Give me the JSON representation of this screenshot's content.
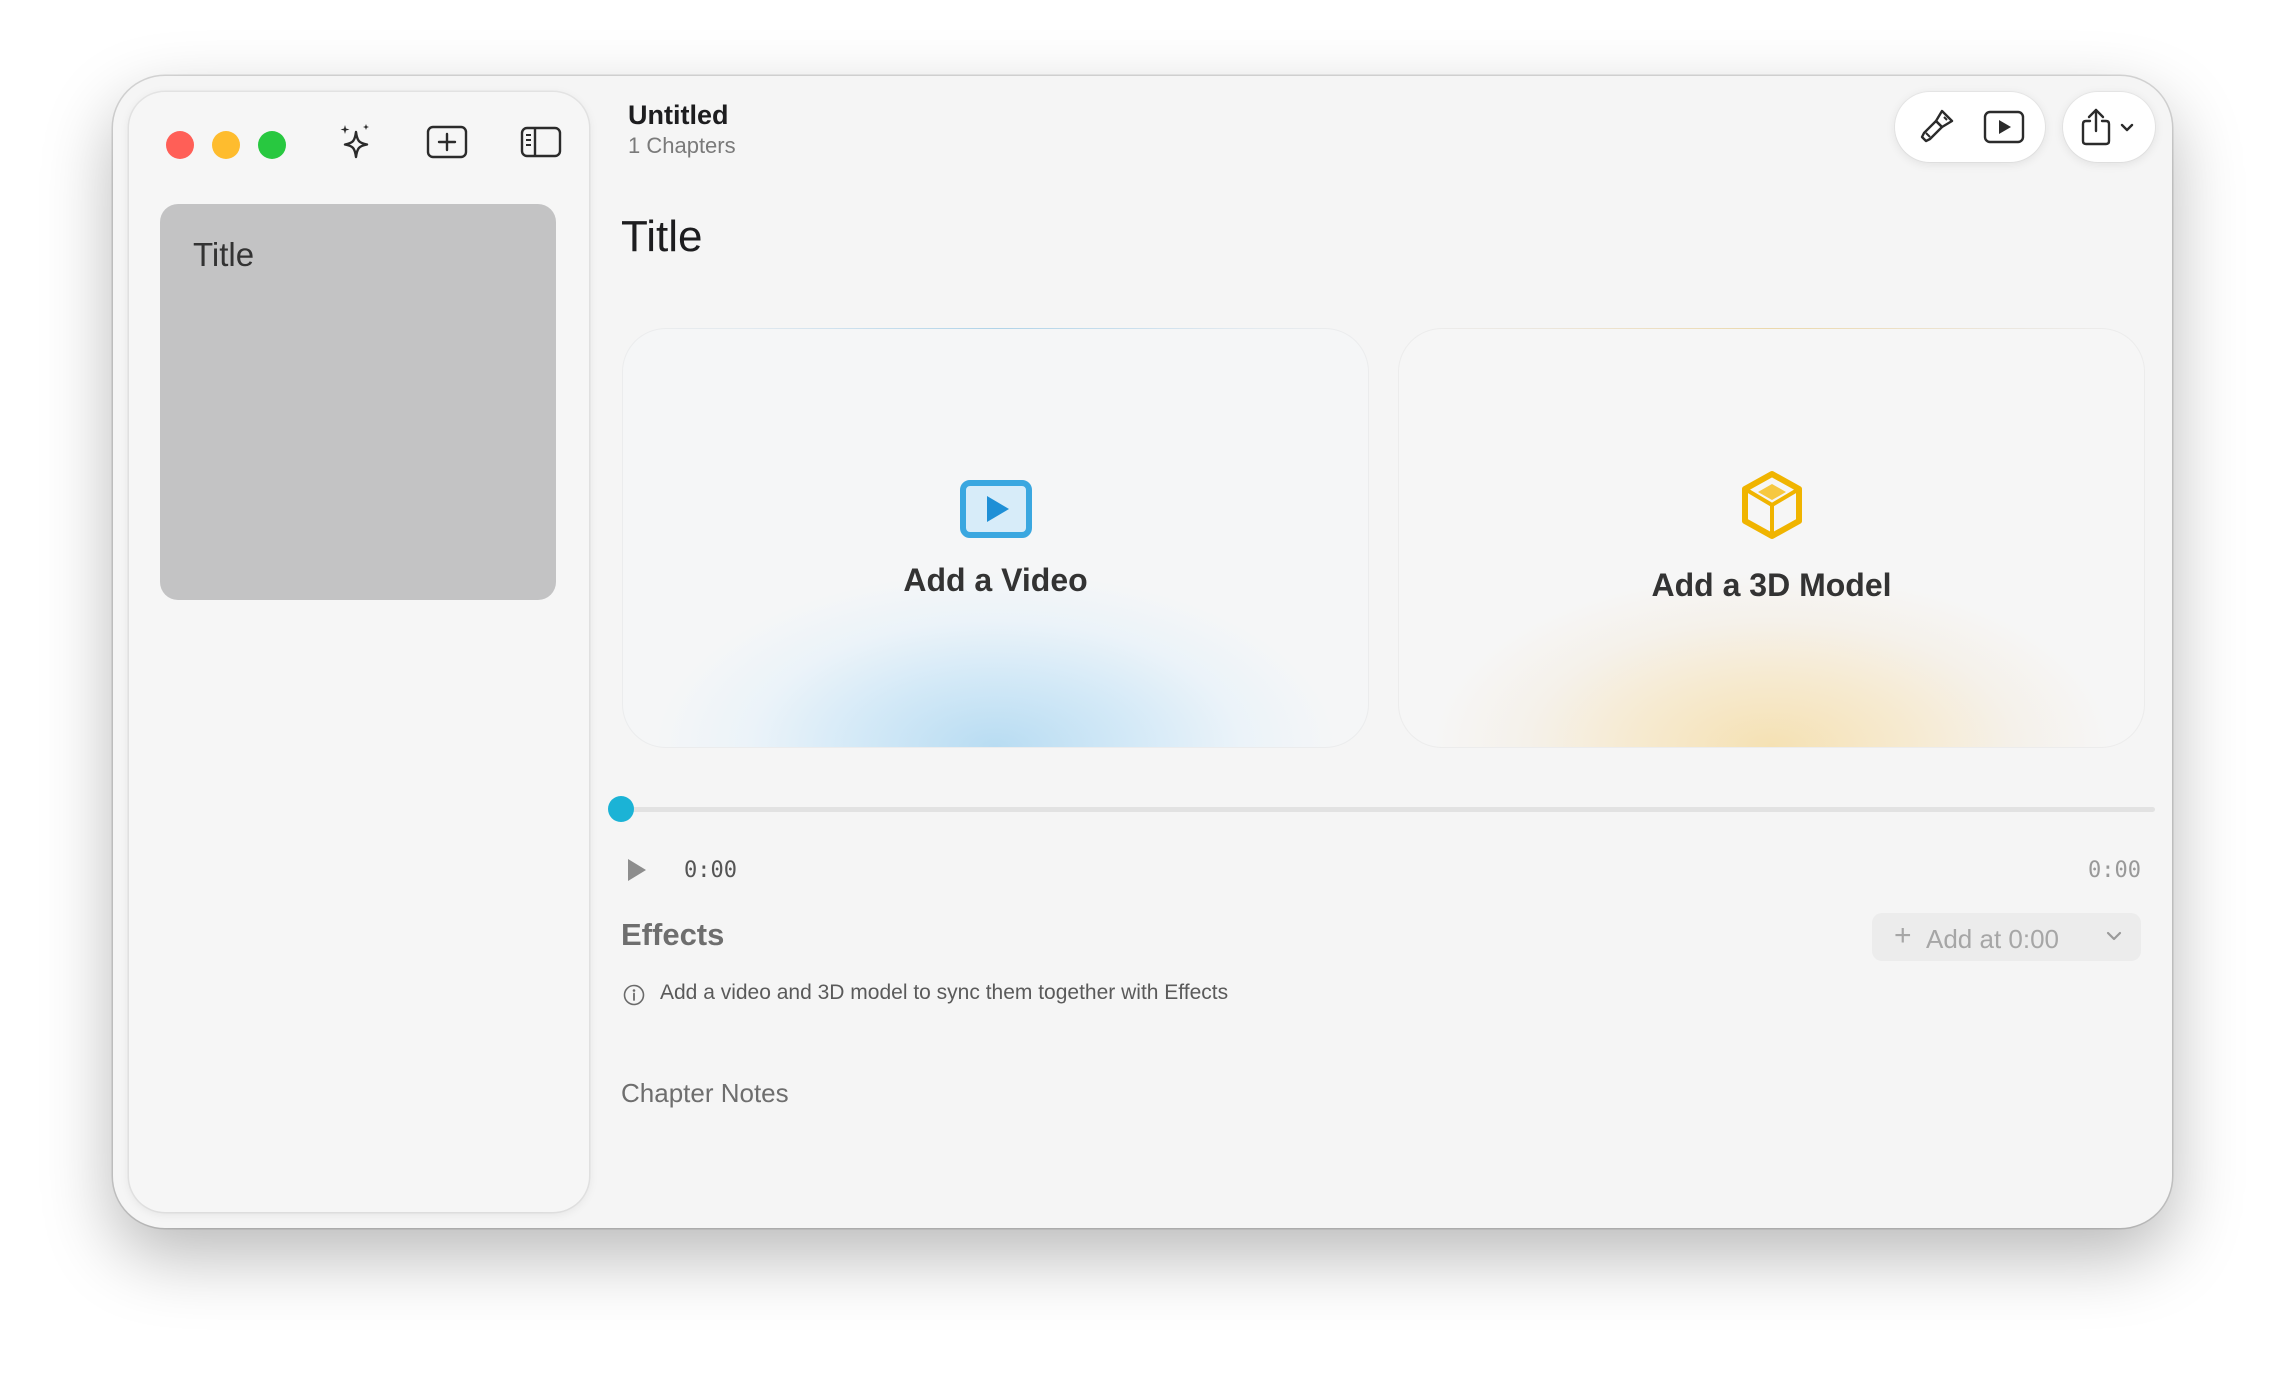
{
  "window": {
    "controls": {
      "close": "close",
      "minimize": "minimize",
      "zoom": "zoom"
    },
    "toolbar_icons": [
      "sparkles-icon",
      "add-chapter-icon",
      "sidebar-toggle-icon"
    ],
    "colors": {
      "close": "#ff5f57",
      "minimize": "#febc2e",
      "zoom": "#28c840",
      "accent": "#1bb3d6",
      "video_icon": "#3aa7e0",
      "model_icon": "#f0b400"
    }
  },
  "sidebar": {
    "chapters": [
      {
        "title": "Title"
      }
    ]
  },
  "header": {
    "title": "Untitled",
    "subtitle": "1 Chapters",
    "tools": [
      "paintbrush-icon",
      "play-preview-icon",
      "share-icon",
      "chevron-down-icon"
    ]
  },
  "main": {
    "page_title": "Title",
    "video_card": {
      "label": "Add a Video",
      "icon": "video-play-icon"
    },
    "model_card": {
      "label": "Add a 3D Model",
      "icon": "cube-icon"
    },
    "timeline": {
      "progress": 0,
      "current_time": "0:00",
      "total_time": "0:00"
    },
    "effects": {
      "title": "Effects",
      "add_button": "Add at 0:00",
      "info_text": "Add a video and 3D model to sync them together with Effects"
    },
    "chapter_notes_placeholder": "Chapter Notes"
  }
}
